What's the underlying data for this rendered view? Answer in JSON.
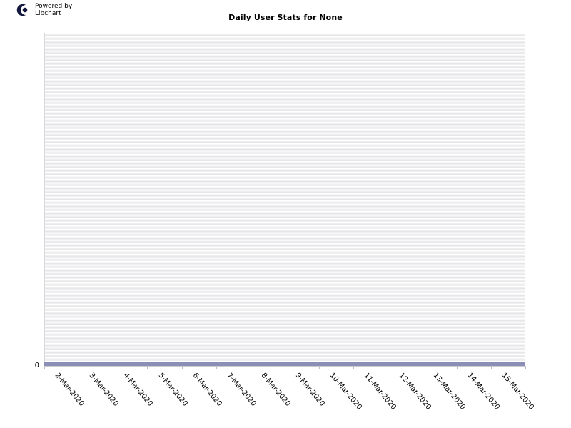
{
  "branding": {
    "logo_icon": "libchart-logo-icon",
    "line1": "Powered by",
    "line2": "Libchart"
  },
  "chart_data": {
    "type": "bar",
    "title": "Daily User Stats for None",
    "xlabel": "",
    "ylabel": "",
    "categories": [
      "2-Mar-2020",
      "3-Mar-2020",
      "4-Mar-2020",
      "5-Mar-2020",
      "6-Mar-2020",
      "7-Mar-2020",
      "8-Mar-2020",
      "9-Mar-2020",
      "10-Mar-2020",
      "11-Mar-2020",
      "12-Mar-2020",
      "13-Mar-2020",
      "14-Mar-2020",
      "15-Mar-2020"
    ],
    "values": [
      0,
      0,
      0,
      0,
      0,
      0,
      0,
      0,
      0,
      0,
      0,
      0,
      0,
      0
    ],
    "y_ticks": [
      "0"
    ],
    "ylim": [
      0,
      0
    ],
    "grid": true,
    "legend": "none",
    "bar_color": "#8b8fb5",
    "plot_background": "#efeff1",
    "gridline_color": "#e6e6e9",
    "axis_color": "#c9c9d2",
    "text_color": "#000000"
  }
}
